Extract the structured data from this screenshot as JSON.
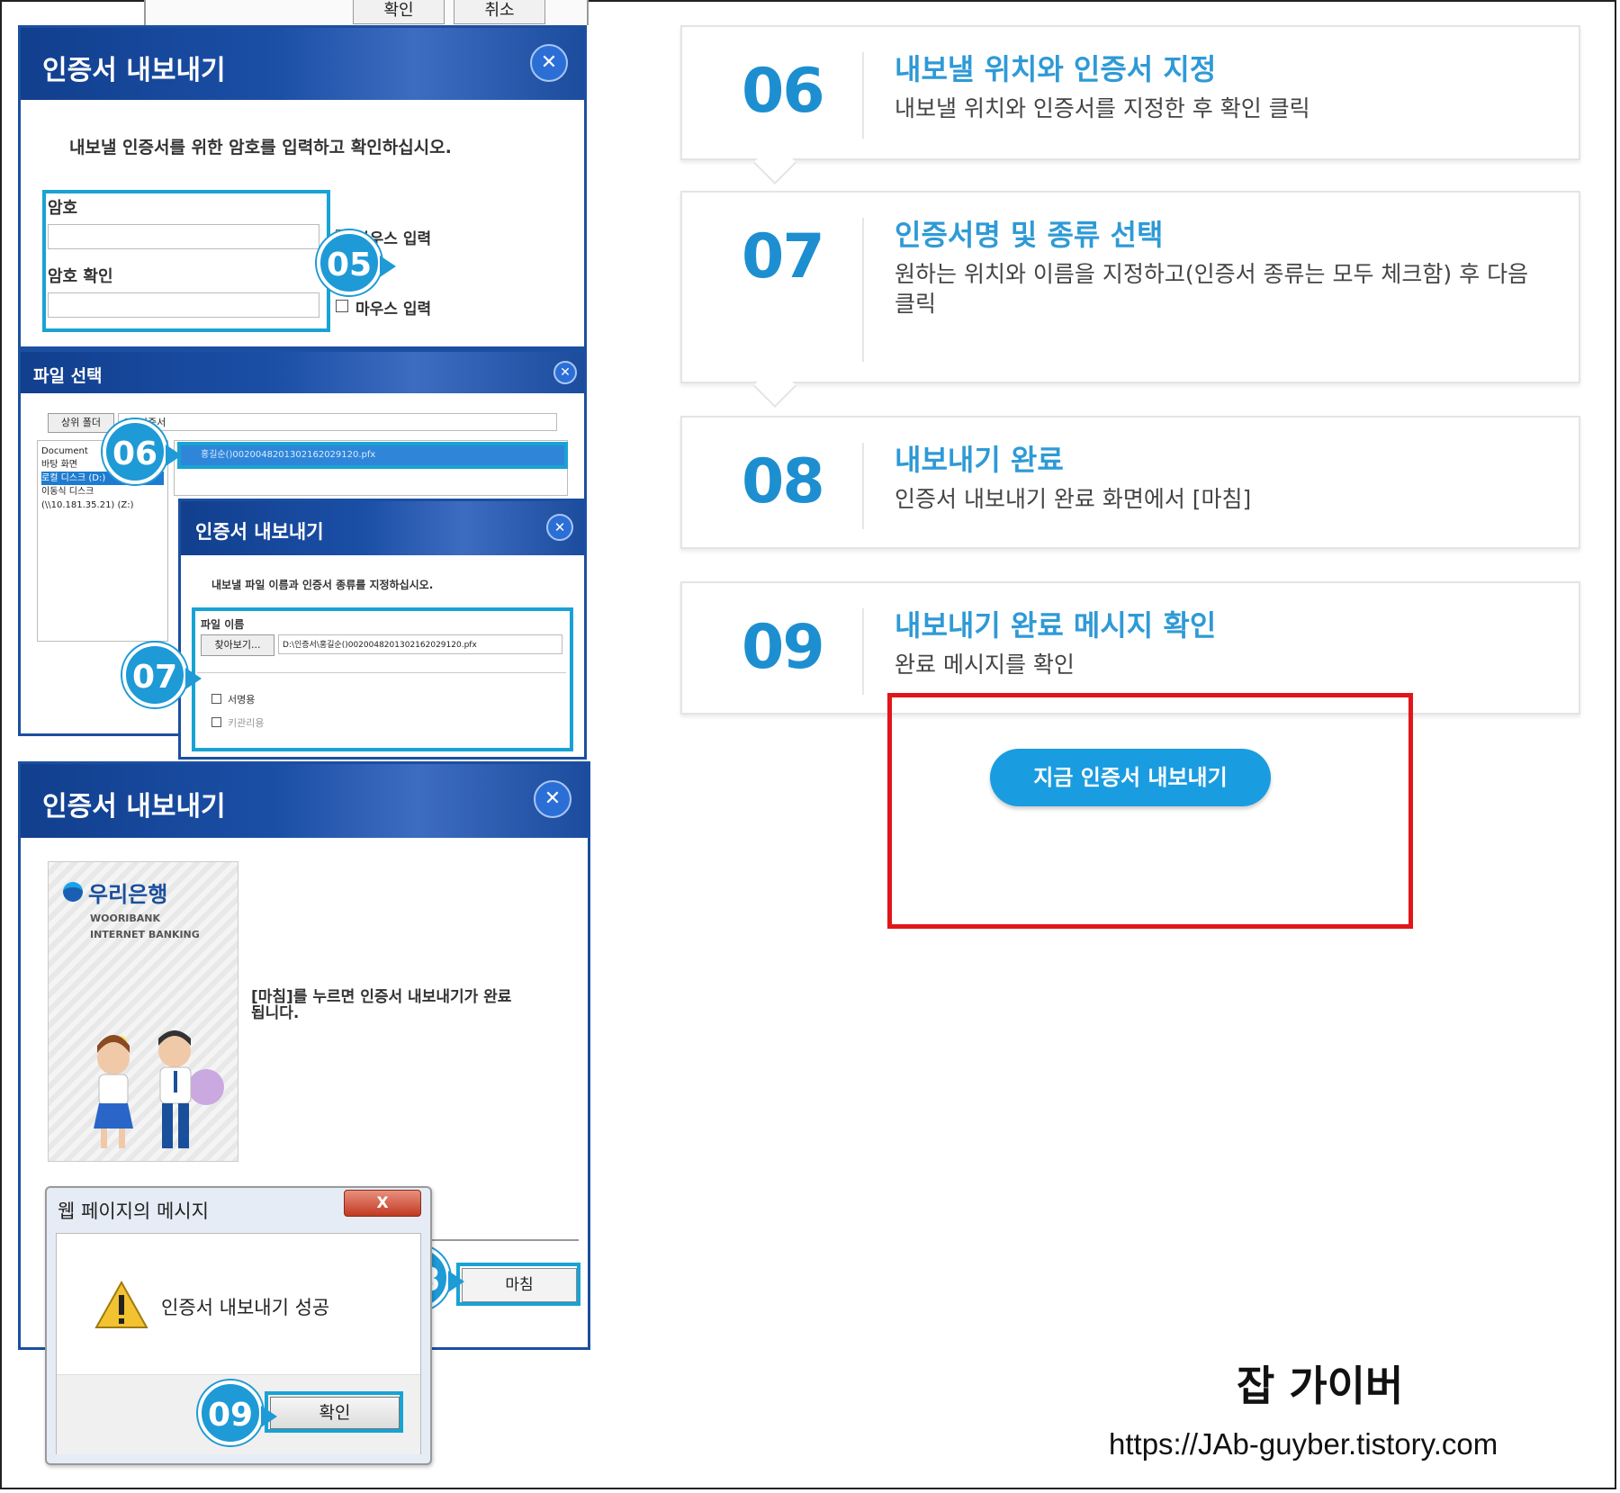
{
  "dialog_password": {
    "title": "인증서 내보내기",
    "instruction": "내보낼 인증서를 위한 암호를 입력하고 확인하십시오.",
    "password_label": "암호",
    "confirm_label": "암호 확인",
    "mouse_input_label": "마우스 입력",
    "top_buttons": [
      "확인",
      "취소"
    ],
    "close_symbol": "✕"
  },
  "dialog_file": {
    "title": "파일 선택",
    "up_button": "상위 폴더",
    "path": "D:\\인증서",
    "tree": [
      "Document",
      "바탕 화면",
      "로컬 디스크 (D:)",
      "이동식 디스크",
      "(\\\\10.181.35.21) (Z:)"
    ],
    "selected_file": "홍길순()0020048201302162029120.pfx"
  },
  "dialog_name": {
    "title": "인증서 내보내기",
    "instruction": "내보낼 파일 이름과 인증서 종류를 지정하십시오.",
    "file_name_label": "파일 이름",
    "browse_button": "찾아보기...",
    "file_path": "D:\\인증서\\홍길순()0020048201302162029120.pfx",
    "options": [
      "서명용",
      "키관리용"
    ]
  },
  "dialog_done": {
    "title": "인증서 내보내기",
    "bank_name": "우리은행",
    "bank_en_1": "WOORIBANK",
    "bank_en_2": "INTERNET  BANKING",
    "message": "[마침]를 누르면 인증서 내보내기가 완료됩니다.",
    "finish_button": "마침"
  },
  "alert": {
    "title": "웹 페이지의 메시지",
    "message": "인증서 내보내기 성공",
    "ok_button": "확인",
    "close_symbol": "X"
  },
  "badges": [
    "05",
    "06",
    "07",
    "08",
    "09"
  ],
  "steps": [
    {
      "num": "06",
      "title": "내보낼 위치와 인증서 지정",
      "desc": "내보낼 위치와 인증서를 지정한 후 확인 클릭"
    },
    {
      "num": "07",
      "title": "인증서명 및 종류 선택",
      "desc": "원하는 위치와 이름을 지정하고(인증서 종류는 모두 체크함) 후 다음 클릭"
    },
    {
      "num": "08",
      "title": "내보내기 완료",
      "desc": "인증서 내보내기 완료 화면에서 [마침]"
    },
    {
      "num": "09",
      "title": "내보내기 완료 메시지 확인",
      "desc": "완료 메시지를 확인"
    }
  ],
  "cta_button": "지금 인증서 내보내기",
  "watermark": {
    "name": "잡 가이버",
    "url": "https://JAb-guyber.tistory.com"
  },
  "colors": {
    "accent": "#1e9ad6",
    "dialog_blue": "#1b4fa0",
    "highlight": "#e0161b"
  }
}
